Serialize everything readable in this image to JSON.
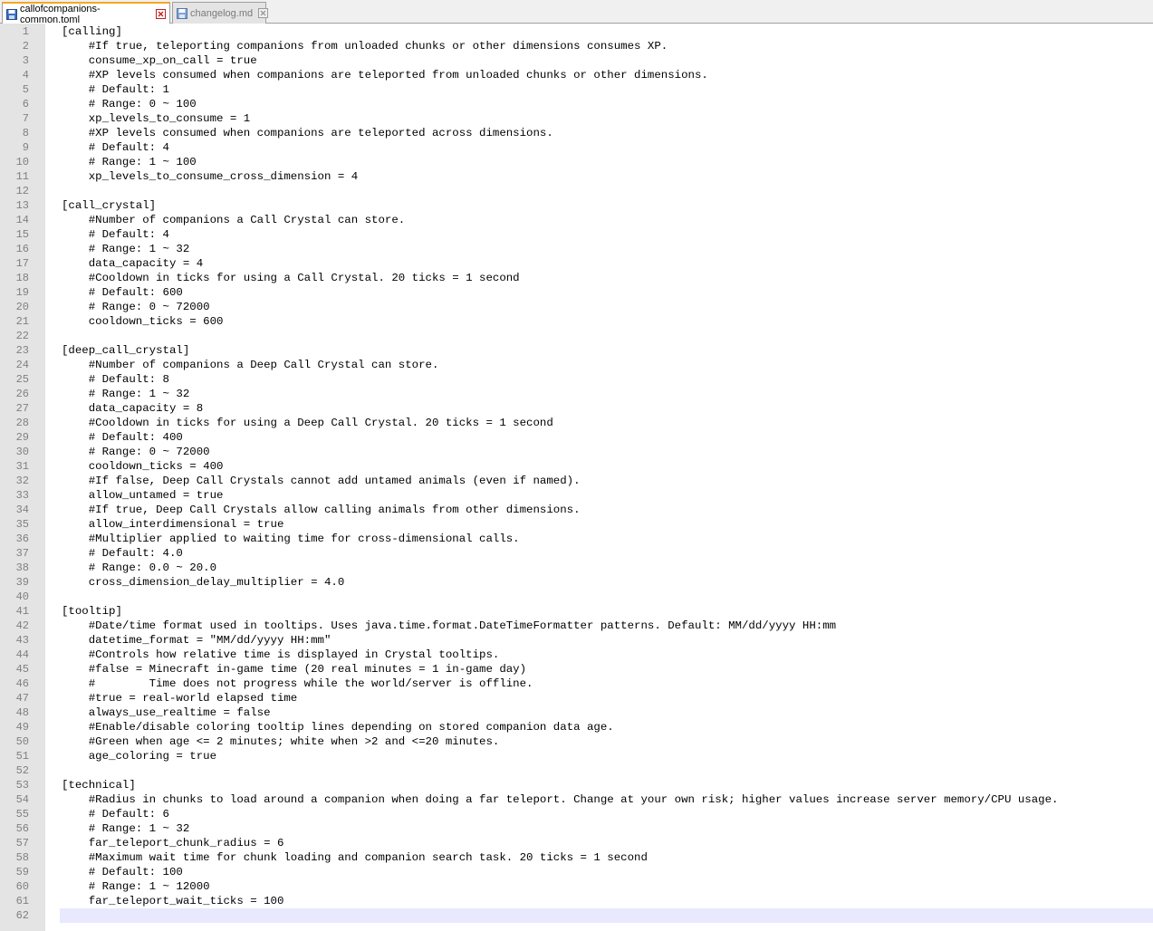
{
  "tabs": [
    {
      "label": "callofcompanions-common.toml",
      "active": true,
      "icon": "floppy-disk-icon"
    },
    {
      "label": "changelog.md",
      "active": false,
      "icon": "floppy-disk-icon"
    }
  ],
  "editor": {
    "current_line": 62,
    "lines": [
      {
        "n": "1",
        "text": "[calling]"
      },
      {
        "n": "2",
        "text": "    #If true, teleporting companions from unloaded chunks or other dimensions consumes XP."
      },
      {
        "n": "3",
        "text": "    consume_xp_on_call = true"
      },
      {
        "n": "4",
        "text": "    #XP levels consumed when companions are teleported from unloaded chunks or other dimensions."
      },
      {
        "n": "5",
        "text": "    # Default: 1"
      },
      {
        "n": "6",
        "text": "    # Range: 0 ~ 100"
      },
      {
        "n": "7",
        "text": "    xp_levels_to_consume = 1"
      },
      {
        "n": "8",
        "text": "    #XP levels consumed when companions are teleported across dimensions."
      },
      {
        "n": "9",
        "text": "    # Default: 4"
      },
      {
        "n": "10",
        "text": "    # Range: 1 ~ 100"
      },
      {
        "n": "11",
        "text": "    xp_levels_to_consume_cross_dimension = 4"
      },
      {
        "n": "12",
        "text": ""
      },
      {
        "n": "13",
        "text": "[call_crystal]"
      },
      {
        "n": "14",
        "text": "    #Number of companions a Call Crystal can store."
      },
      {
        "n": "15",
        "text": "    # Default: 4"
      },
      {
        "n": "16",
        "text": "    # Range: 1 ~ 32"
      },
      {
        "n": "17",
        "text": "    data_capacity = 4"
      },
      {
        "n": "18",
        "text": "    #Cooldown in ticks for using a Call Crystal. 20 ticks = 1 second"
      },
      {
        "n": "19",
        "text": "    # Default: 600"
      },
      {
        "n": "20",
        "text": "    # Range: 0 ~ 72000"
      },
      {
        "n": "21",
        "text": "    cooldown_ticks = 600"
      },
      {
        "n": "22",
        "text": ""
      },
      {
        "n": "23",
        "text": "[deep_call_crystal]"
      },
      {
        "n": "24",
        "text": "    #Number of companions a Deep Call Crystal can store."
      },
      {
        "n": "25",
        "text": "    # Default: 8"
      },
      {
        "n": "26",
        "text": "    # Range: 1 ~ 32"
      },
      {
        "n": "27",
        "text": "    data_capacity = 8"
      },
      {
        "n": "28",
        "text": "    #Cooldown in ticks for using a Deep Call Crystal. 20 ticks = 1 second"
      },
      {
        "n": "29",
        "text": "    # Default: 400"
      },
      {
        "n": "30",
        "text": "    # Range: 0 ~ 72000"
      },
      {
        "n": "31",
        "text": "    cooldown_ticks = 400"
      },
      {
        "n": "32",
        "text": "    #If false, Deep Call Crystals cannot add untamed animals (even if named)."
      },
      {
        "n": "33",
        "text": "    allow_untamed = true"
      },
      {
        "n": "34",
        "text": "    #If true, Deep Call Crystals allow calling animals from other dimensions."
      },
      {
        "n": "35",
        "text": "    allow_interdimensional = true"
      },
      {
        "n": "36",
        "text": "    #Multiplier applied to waiting time for cross-dimensional calls."
      },
      {
        "n": "37",
        "text": "    # Default: 4.0"
      },
      {
        "n": "38",
        "text": "    # Range: 0.0 ~ 20.0"
      },
      {
        "n": "39",
        "text": "    cross_dimension_delay_multiplier = 4.0"
      },
      {
        "n": "40",
        "text": ""
      },
      {
        "n": "41",
        "text": "[tooltip]"
      },
      {
        "n": "42",
        "text": "    #Date/time format used in tooltips. Uses java.time.format.DateTimeFormatter patterns. Default: MM/dd/yyyy HH:mm"
      },
      {
        "n": "43",
        "text": "    datetime_format = \"MM/dd/yyyy HH:mm\""
      },
      {
        "n": "44",
        "text": "    #Controls how relative time is displayed in Crystal tooltips."
      },
      {
        "n": "45",
        "text": "    #false = Minecraft in-game time (20 real minutes = 1 in-game day)"
      },
      {
        "n": "46",
        "text": "    #        Time does not progress while the world/server is offline."
      },
      {
        "n": "47",
        "text": "    #true = real-world elapsed time"
      },
      {
        "n": "48",
        "text": "    always_use_realtime = false"
      },
      {
        "n": "49",
        "text": "    #Enable/disable coloring tooltip lines depending on stored companion data age."
      },
      {
        "n": "50",
        "text": "    #Green when age <= 2 minutes; white when >2 and <=20 minutes."
      },
      {
        "n": "51",
        "text": "    age_coloring = true"
      },
      {
        "n": "52",
        "text": ""
      },
      {
        "n": "53",
        "text": "[technical]"
      },
      {
        "n": "54",
        "text": "    #Radius in chunks to load around a companion when doing a far teleport. Change at your own risk; higher values increase server memory/CPU usage."
      },
      {
        "n": "55",
        "text": "    # Default: 6"
      },
      {
        "n": "56",
        "text": "    # Range: 1 ~ 32"
      },
      {
        "n": "57",
        "text": "    far_teleport_chunk_radius = 6"
      },
      {
        "n": "58",
        "text": "    #Maximum wait time for chunk loading and companion search task. 20 ticks = 1 second"
      },
      {
        "n": "59",
        "text": "    # Default: 100"
      },
      {
        "n": "60",
        "text": "    # Range: 1 ~ 12000"
      },
      {
        "n": "61",
        "text": "    far_teleport_wait_ticks = 100"
      },
      {
        "n": "62",
        "text": ""
      }
    ]
  },
  "colors": {
    "comment": "#808080",
    "text": "#000000",
    "gutter_bg": "#e4e4e4",
    "current_line_bg": "#e8e8ff",
    "active_tab_accent": "#f5a623"
  }
}
